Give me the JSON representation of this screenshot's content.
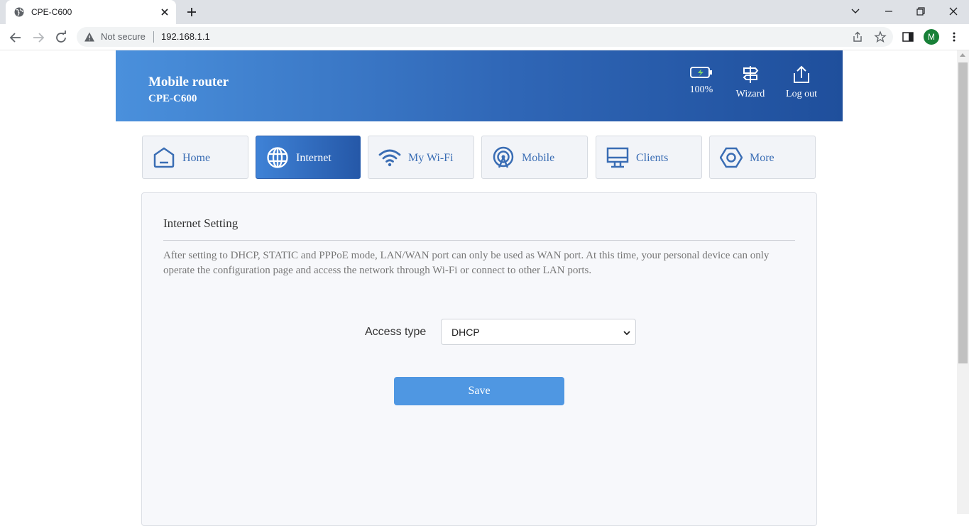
{
  "browser": {
    "tab_title": "CPE-C600",
    "security_label": "Not secure",
    "url": "192.168.1.1",
    "profile_initial": "M"
  },
  "header": {
    "brand_title": "Mobile router",
    "brand_model": "CPE-C600",
    "battery_label": "100%",
    "battery_level": 1.0,
    "wizard_label": "Wizard",
    "logout_label": "Log out"
  },
  "nav": {
    "tabs": [
      {
        "label": "Home",
        "icon": "home-icon"
      },
      {
        "label": "Internet",
        "icon": "globe-icon",
        "active": true
      },
      {
        "label": "My Wi-Fi",
        "icon": "wifi-icon"
      },
      {
        "label": "Mobile",
        "icon": "antenna-icon"
      },
      {
        "label": "Clients",
        "icon": "monitor-icon"
      },
      {
        "label": "More",
        "icon": "hexagon-icon"
      }
    ]
  },
  "panel": {
    "title": "Internet Setting",
    "description": "After setting to DHCP, STATIC and PPPoE mode, LAN/WAN port can only be used as WAN port. At this time, your personal device can only operate the configuration page and access the network through Wi-Fi or connect to other LAN ports.",
    "access_type_label": "Access type",
    "access_type_value": "DHCP",
    "save_label": "Save"
  },
  "colors": {
    "header_start": "#4a90dc",
    "header_end": "#1f4f9c",
    "accent": "#3a6db4",
    "save_button": "#4f97e2"
  }
}
